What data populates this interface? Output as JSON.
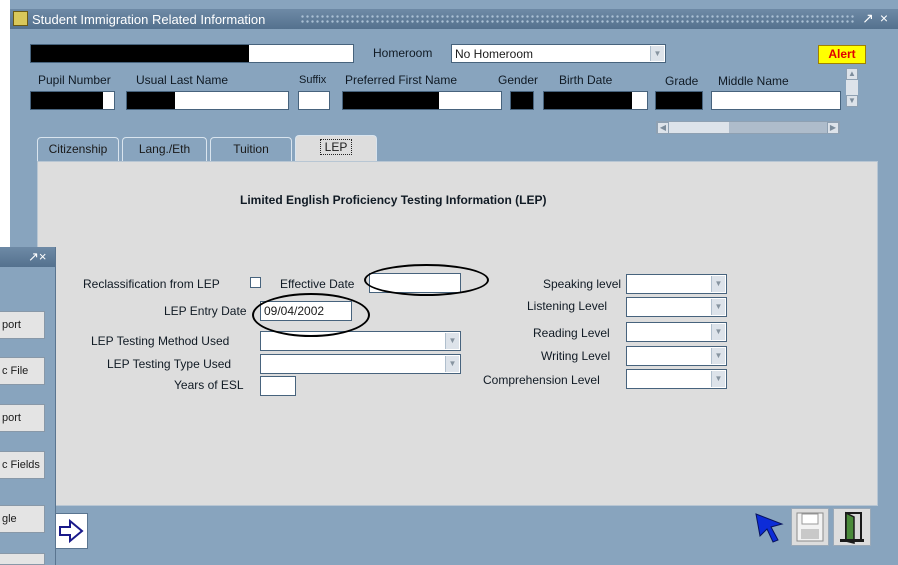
{
  "window": {
    "title": "Student Immigration Related Information",
    "title_controls": [
      "↗",
      "×"
    ]
  },
  "header": {
    "homeroom_label": "Homeroom",
    "homeroom_value": "No Homeroom",
    "alert_label": "Alert",
    "columns": {
      "pupil_number": "Pupil Number",
      "usual_last_name": "Usual Last Name",
      "suffix": "Suffix",
      "preferred_first_name": "Preferred First Name",
      "gender": "Gender",
      "birth_date": "Birth Date",
      "grade": "Grade",
      "middle_name": "Middle Name"
    }
  },
  "tabs": [
    {
      "label": "Citizenship",
      "active": false
    },
    {
      "label": "Lang./Eth",
      "active": false
    },
    {
      "label": "Tuition",
      "active": false
    },
    {
      "label": "LEP",
      "active": true
    }
  ],
  "lep": {
    "heading": "Limited English Proficiency Testing Information (LEP)",
    "reclassification_label": "Reclassification from LEP",
    "reclassification_checked": false,
    "effective_date_label": "Effective Date",
    "effective_date_value": "",
    "entry_date_label": "LEP Entry Date",
    "entry_date_value": "09/04/2002",
    "testing_method_label": "LEP Testing Method Used",
    "testing_method_value": "",
    "testing_type_label": "LEP Testing Type Used",
    "testing_type_value": "",
    "years_esl_label": "Years of ESL",
    "years_esl_value": "",
    "speaking_label": "Speaking level",
    "listening_label": "Listening Level",
    "reading_label": "Reading Level",
    "writing_label": "Writing Level",
    "comprehension_label": "Comprehension Level"
  },
  "side_window": {
    "controls": "↗×",
    "buttons": [
      "port",
      "c File",
      "port",
      "c Fields",
      "gle"
    ]
  },
  "colors": {
    "window_bg": "#88a4be",
    "panel_bg": "#dddddd",
    "title_bar": "#5f7b98",
    "alert_bg": "#ffff00",
    "alert_text": "#e00000"
  },
  "icons": {
    "next": "arrow-right-icon",
    "pointer": "cursor-arrow-icon",
    "save": "floppy-disk-icon",
    "exit": "door-exit-icon"
  }
}
